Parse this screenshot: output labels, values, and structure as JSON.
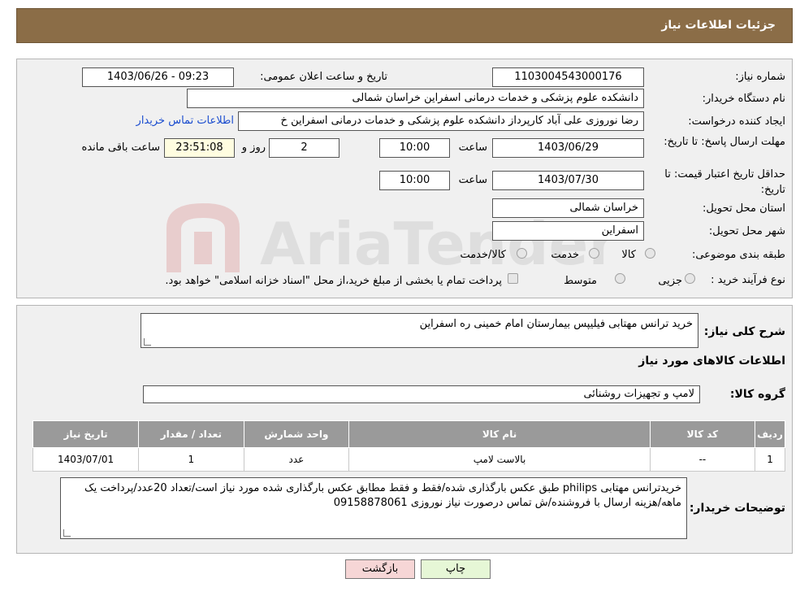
{
  "page_title": "جزئیات اطلاعات نیاز",
  "labels": {
    "need_number": "شماره نیاز:",
    "announce_datetime": "تاریخ و ساعت اعلان عمومی:",
    "buyer_org": "نام دستگاه خریدار:",
    "requester": "ایجاد کننده درخواست:",
    "reply_deadline": "مهلت ارسال پاسخ: تا تاریخ:",
    "price_validity": "حداقل تاریخ اعتبار قیمت: تا تاریخ:",
    "time": "ساعت",
    "days_and": "روز و",
    "time_remaining": "ساعت باقی مانده",
    "province": "استان محل تحویل:",
    "city": "شهر محل تحویل:",
    "category": "طبقه بندی موضوعی:",
    "purchase_type": "نوع فرآیند خرید :",
    "general_desc": "شرح کلی نیاز:",
    "goods_info": "اطلاعات کالاهای مورد نیاز",
    "goods_group": "گروه کالا:",
    "buyer_notes": "توضیحات خریدار:"
  },
  "values": {
    "need_number": "1103004543000176",
    "announce_datetime": "1403/06/26 - 09:23",
    "buyer_org": "دانشکده علوم پزشکی و خدمات درمانی اسفراین خراسان شمالی",
    "requester": "رضا نوروزی علی آباد کارپرداز  دانشکده علوم پزشکی و خدمات درمانی اسفراین خ",
    "contact_link": "اطلاعات تماس خریدار",
    "reply_date": "1403/06/29",
    "reply_time": "10:00",
    "days_left": "2",
    "time_left": "23:51:08",
    "validity_date": "1403/07/30",
    "validity_time": "10:00",
    "province": "خراسان شمالی",
    "city": "اسفراین",
    "general_desc": "خرید ترانس مهتابی فیلیپس بیمارستان امام خمینی ره اسفراین",
    "goods_group": "لامپ و تجهیزات روشنائی",
    "buyer_notes": "خریدترانس مهتابی philips طبق عکس بارگذاری شده/فقط و فقط مطابق عکس بارگذاری شده مورد نیاز است/تعداد 20عدد/پرداخت یک ماهه/هزینه ارسال با فروشنده/ش تماس درصورت نیاز نوروزی 09158878061"
  },
  "category_options": [
    "کالا",
    "خدمت",
    "کالا/خدمت"
  ],
  "purchase_options": [
    "جزیی",
    "متوسط"
  ],
  "purchase_note": "پرداخت تمام یا بخشی از مبلغ خرید،از محل \"اسناد خزانه اسلامی\" خواهد بود.",
  "table": {
    "headers": [
      "ردیف",
      "کد کالا",
      "نام کالا",
      "واحد شمارش",
      "تعداد / مقدار",
      "تاریخ نیاز"
    ],
    "rows": [
      [
        "1",
        "--",
        "بالاست لامپ",
        "عدد",
        "1",
        "1403/07/01"
      ]
    ]
  },
  "buttons": {
    "back": "بازگشت",
    "print": "چاپ"
  },
  "watermark_text": "AriaTender.neT",
  "colors": {
    "header": "#8b6d47",
    "back_button": "#f6d6d6",
    "print_button": "#e6f7d6",
    "link": "#1a4ccf"
  }
}
